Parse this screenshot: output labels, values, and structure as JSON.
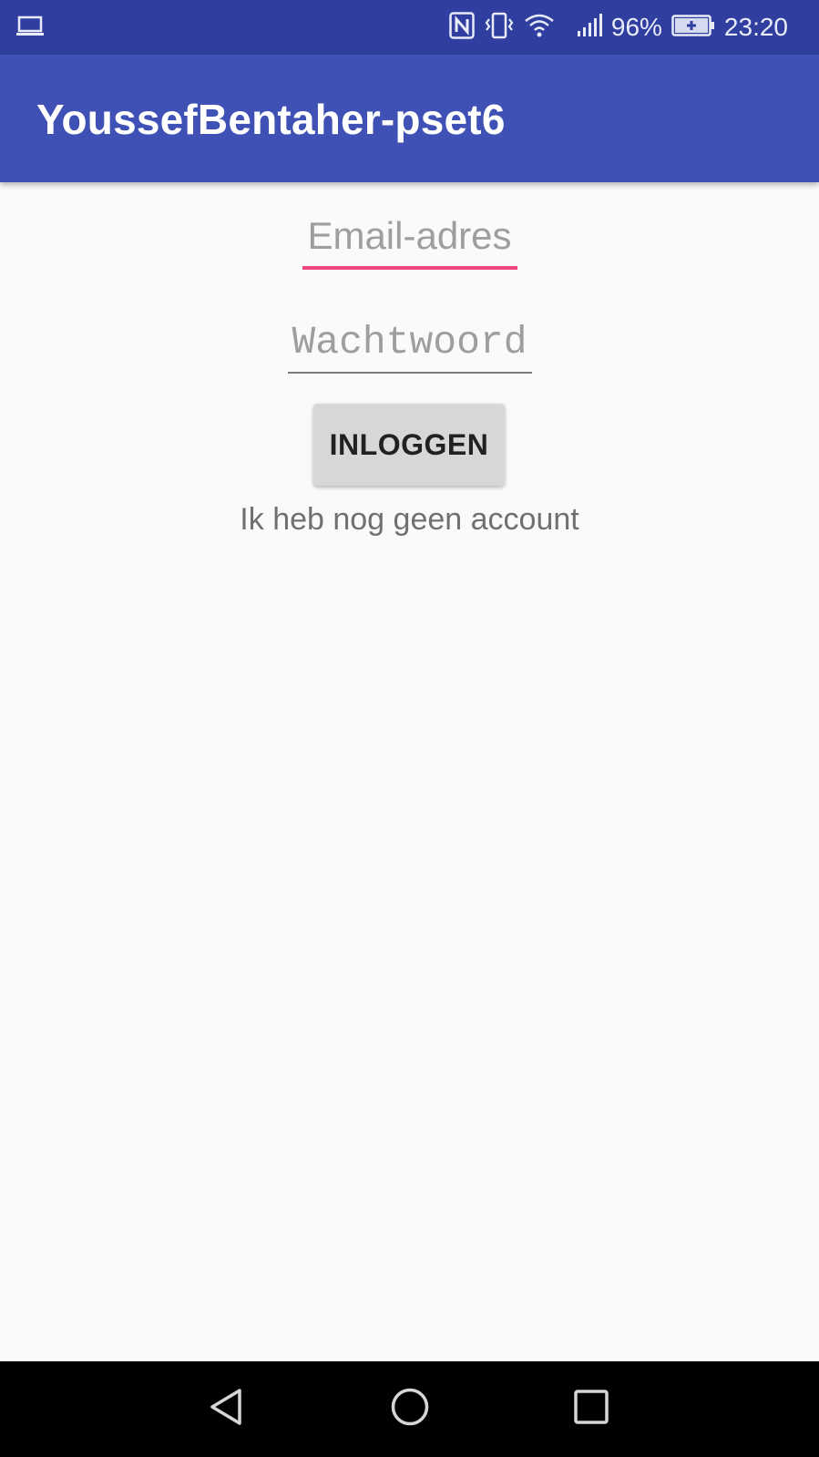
{
  "status_bar": {
    "battery_percent": "96%",
    "time": "23:20",
    "icons": [
      "laptop-icon",
      "nfc-icon",
      "vibrate-icon",
      "wifi-icon",
      "signal-icon",
      "battery-charging-icon"
    ]
  },
  "app_bar": {
    "title": "YoussefBentaher-pset6"
  },
  "form": {
    "email_placeholder": "Email-adres",
    "password_placeholder": "Wachtwoord",
    "login_label": "INLOGGEN",
    "signup_link": "Ik heb nog geen account"
  },
  "nav_bar": {
    "icons": [
      "back-icon",
      "home-icon",
      "recents-icon"
    ]
  },
  "colors": {
    "status_bar": "#303f9f",
    "app_bar": "#3f51b5",
    "accent": "#ee4580",
    "background": "#fafafa"
  }
}
